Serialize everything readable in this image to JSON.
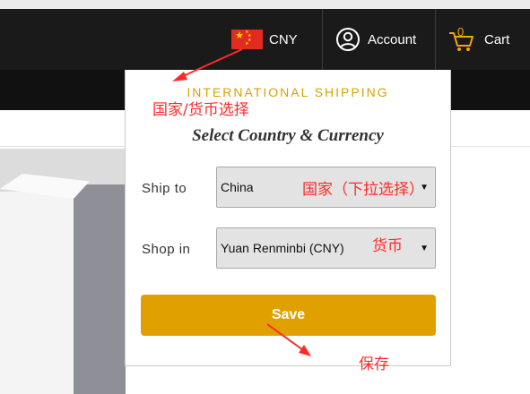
{
  "header": {
    "currency": {
      "code": "CNY",
      "flag_icon": "china-flag-icon"
    },
    "account": {
      "label": "Account",
      "icon": "user-circle-icon"
    },
    "cart": {
      "label": "Cart",
      "count": "0",
      "icon": "cart-icon"
    }
  },
  "dropdown": {
    "kicker": "INTERNATIONAL SHIPPING",
    "title": "Select Country & Currency",
    "ship_to": {
      "label": "Ship to",
      "value": "China"
    },
    "shop_in": {
      "label": "Shop in",
      "value": "Yuan Renminbi (CNY)"
    },
    "save_label": "Save"
  },
  "annotations": {
    "currency_select": "国家/货币选择",
    "country_select": "国家（下拉选择）",
    "currency": "货币",
    "save": "保存"
  },
  "colors": {
    "header_bg": "#1a1a1a",
    "accent": "#e0a000",
    "annotation": "#ff2a2a",
    "flag_red": "#e02b1e",
    "flag_yellow": "#ffde00"
  }
}
